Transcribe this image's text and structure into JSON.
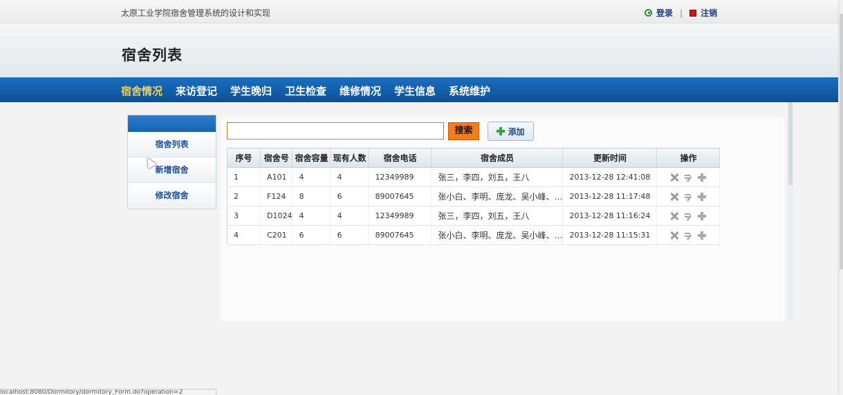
{
  "topbar": {
    "site_name": "太原工业学院宿舍管理系统的设计和实现",
    "login": "登录",
    "separator": "|",
    "logout": "注销"
  },
  "header": {
    "title": "宿舍列表"
  },
  "nav": {
    "items": [
      "宿舍情况",
      "来访登记",
      "学生晚归",
      "卫生检查",
      "维修情况",
      "学生信息",
      "系统维护"
    ],
    "active_index": 0
  },
  "sidebar": {
    "items": [
      "宿舍列表",
      "新增宿舍",
      "修改宿舍"
    ]
  },
  "toolbar": {
    "search_value": "",
    "search_label": "搜索",
    "add_label": "添加"
  },
  "table": {
    "headers": [
      "序号",
      "宿舍号",
      "宿舍容量",
      "现有人数",
      "宿舍电话",
      "宿舍成员",
      "更新时间",
      "操作"
    ],
    "rows": [
      {
        "no": "1",
        "room": "A101",
        "capacity": "4",
        "current": "4",
        "phone": "12349989",
        "members": "张三，李四，刘五，王八",
        "updated": "2013-12-28 12:41:08"
      },
      {
        "no": "2",
        "room": "F124",
        "capacity": "8",
        "current": "6",
        "phone": "89007645",
        "members": "张小白、李明、庞龙、吴小峰、…",
        "updated": "2013-12-28 11:17:48"
      },
      {
        "no": "3",
        "room": "D1024",
        "capacity": "4",
        "current": "4",
        "phone": "12349989",
        "members": "张三，李四，刘五，王八",
        "updated": "2013-12-28 11:16:24"
      },
      {
        "no": "4",
        "room": "C201",
        "capacity": "6",
        "current": "6",
        "phone": "89007645",
        "members": "张小白、李明、庞龙、吴小峰、…",
        "updated": "2013-12-28 11:15:31"
      }
    ]
  },
  "statusbar": {
    "text": "localhost:8080/Dormitory/dormitory_Form.do?operation=2"
  },
  "colors": {
    "nav_bg": "#0d5ba8",
    "nav_active": "#f5d54a",
    "search_button": "#f07e1d"
  }
}
